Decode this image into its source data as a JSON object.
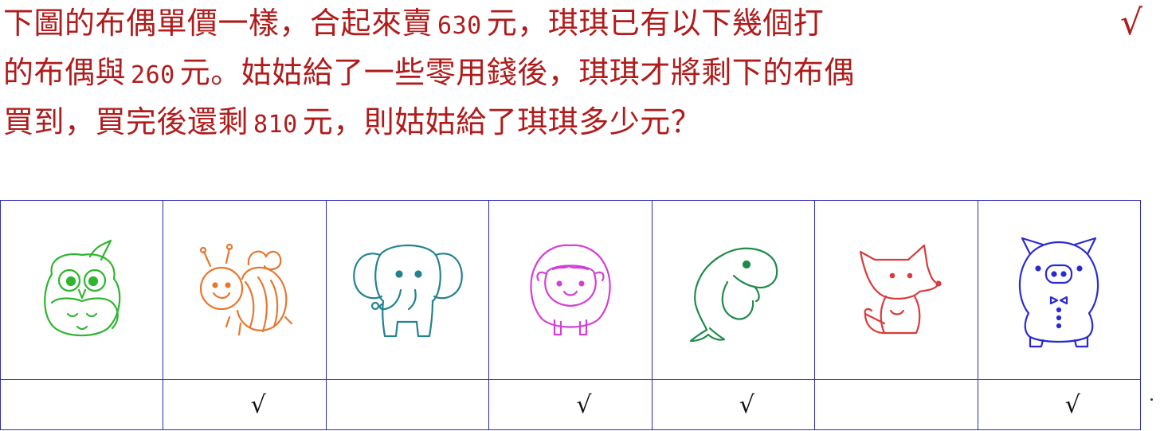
{
  "question": {
    "line1_a": "下圖的布偶單價一樣，合起來賣",
    "line1_num": "630",
    "line1_b": "元，琪琪已有以下幾個打",
    "check_symbol": "√",
    "line2_a": "的布偶與",
    "line2_num": "260",
    "line2_b": "元。姑姑給了一些零用錢後，琪琪才將剩下的布偶",
    "line3_a": "買到，買完後還剩",
    "line3_num": "810",
    "line3_b": "元，則姑姑給了琪琪多少元？"
  },
  "toys": [
    {
      "icon": "owl-icon",
      "color": "#2fb52f",
      "checked": false,
      "mark": ""
    },
    {
      "icon": "bee-icon",
      "color": "#e8772e",
      "checked": true,
      "mark": "√"
    },
    {
      "icon": "elephant-icon",
      "color": "#23828f",
      "checked": false,
      "mark": ""
    },
    {
      "icon": "sheep-icon",
      "color": "#d43fd4",
      "checked": true,
      "mark": "√"
    },
    {
      "icon": "whale-icon",
      "color": "#1f8a4a",
      "checked": true,
      "mark": "√"
    },
    {
      "icon": "fox-icon",
      "color": "#d93a3a",
      "checked": false,
      "mark": ""
    },
    {
      "icon": "pig-icon",
      "color": "#2a2ad0",
      "checked": true,
      "mark": "√"
    }
  ],
  "colors": {
    "question_text": "#b01c1c",
    "grid_border": "#2b2bb8"
  }
}
